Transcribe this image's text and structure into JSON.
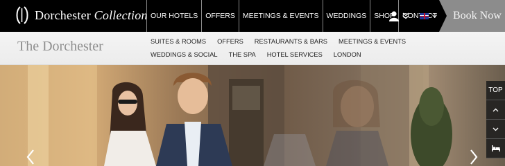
{
  "brand": {
    "name_regular": "Dorchester",
    "name_italic": "Collection"
  },
  "main_nav": [
    "OUR HOTELS",
    "OFFERS",
    "MEETINGS & EVENTS",
    "WEDDINGS",
    "SHOP",
    "CONTACT US"
  ],
  "header_actions": {
    "user_icon": "user-icon",
    "language_flag": "uk-flag-icon",
    "book_now": "Book Now"
  },
  "hotel": {
    "name": "The Dorchester"
  },
  "sub_nav": [
    "SUITES & ROOMS",
    "OFFERS",
    "RESTAURANTS & BARS",
    "MEETINGS & EVENTS",
    "WEDDINGS & SOCIAL",
    "THE SPA",
    "HOTEL SERVICES",
    "LONDON"
  ],
  "side_tools": {
    "top_label": "TOP",
    "icons": [
      "chevron-up-icon",
      "chevron-down-icon",
      "bed-icon"
    ]
  },
  "carousel": {
    "prev_icon": "chevron-left-icon",
    "next_icon": "chevron-right-icon"
  },
  "colors": {
    "topbar": "#000000",
    "book_now_bg": "#8c8c8c",
    "subbar_bg": "#efefef",
    "hotel_name": "#8e8e8e"
  }
}
